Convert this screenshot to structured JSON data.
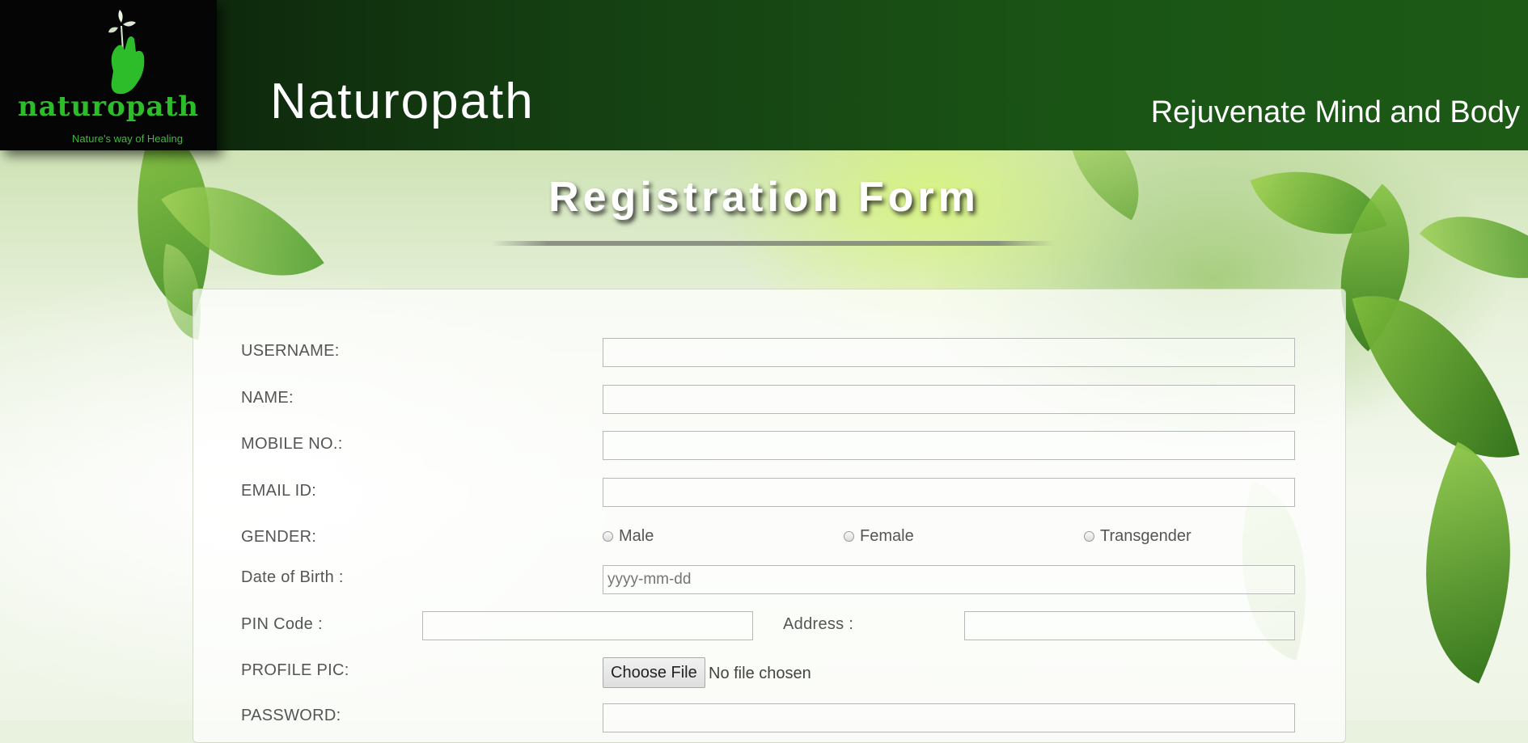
{
  "header": {
    "logo_text": "naturopath",
    "logo_tagline": "Nature's way of Healing",
    "site_title": "Naturopath",
    "tagline": "Rejuvenate Mind and Body"
  },
  "form": {
    "heading": "Registration Form",
    "fields": {
      "username": {
        "label": "USERNAME:",
        "value": ""
      },
      "name": {
        "label": "NAME:",
        "value": ""
      },
      "mobile": {
        "label": "MOBILE NO.:",
        "value": ""
      },
      "email": {
        "label": "EMAIL ID:",
        "value": ""
      },
      "gender": {
        "label": "GENDER:",
        "options": [
          "Male",
          "Female",
          "Transgender"
        ],
        "selected": ""
      },
      "dob": {
        "label": "Date of Birth :",
        "placeholder": "yyyy-mm-dd"
      },
      "pin": {
        "label": "PIN Code :",
        "value": ""
      },
      "address": {
        "label": "Address :",
        "value": ""
      },
      "profile_pic": {
        "label": "PROFILE PIC:",
        "button_label": "Choose File",
        "status": "No file chosen"
      },
      "password": {
        "label": "PASSWORD:",
        "value": ""
      }
    }
  },
  "colors": {
    "header_dark": "#0a1a08",
    "header_green": "#1c5a16",
    "logo_green": "#2ebd2a"
  }
}
